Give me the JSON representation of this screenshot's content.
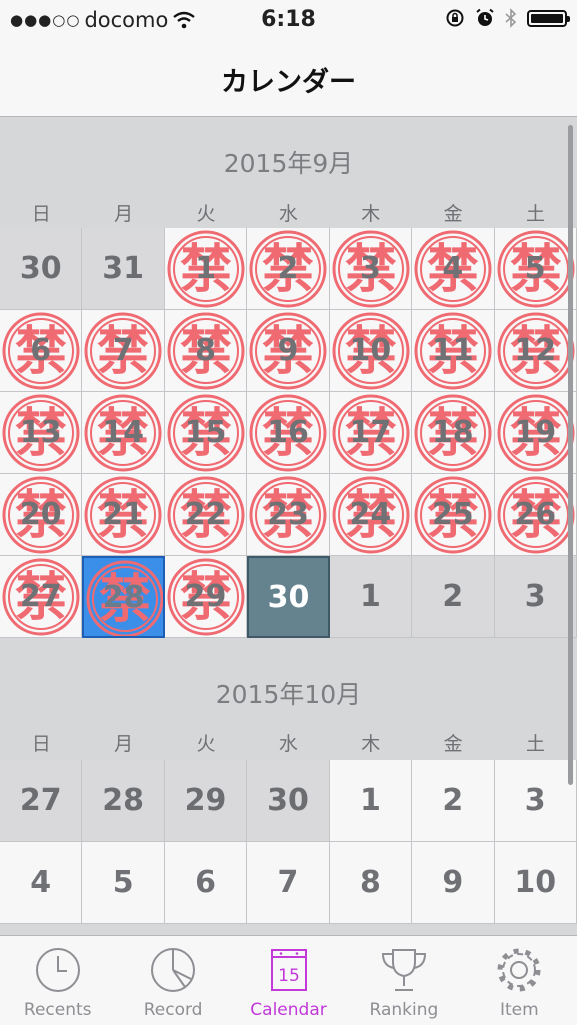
{
  "status_bar": {
    "signal": "●●●○○",
    "carrier": "docomo",
    "time": "6:18"
  },
  "nav": {
    "title": "カレンダー"
  },
  "weekdays": [
    "日",
    "月",
    "火",
    "水",
    "木",
    "金",
    "土"
  ],
  "months": [
    {
      "title": "2015年9月",
      "days": [
        {
          "n": "30",
          "other": true,
          "stamp": false
        },
        {
          "n": "31",
          "other": true,
          "stamp": false
        },
        {
          "n": "1",
          "stamp": true
        },
        {
          "n": "2",
          "stamp": true
        },
        {
          "n": "3",
          "stamp": true
        },
        {
          "n": "4",
          "stamp": true
        },
        {
          "n": "5",
          "stamp": true
        },
        {
          "n": "6",
          "stamp": true
        },
        {
          "n": "7",
          "stamp": true
        },
        {
          "n": "8",
          "stamp": true
        },
        {
          "n": "9",
          "stamp": true
        },
        {
          "n": "10",
          "stamp": true
        },
        {
          "n": "11",
          "stamp": true
        },
        {
          "n": "12",
          "stamp": true
        },
        {
          "n": "13",
          "stamp": true
        },
        {
          "n": "14",
          "stamp": true
        },
        {
          "n": "15",
          "stamp": true
        },
        {
          "n": "16",
          "stamp": true
        },
        {
          "n": "17",
          "stamp": true
        },
        {
          "n": "18",
          "stamp": true
        },
        {
          "n": "19",
          "stamp": true
        },
        {
          "n": "20",
          "stamp": true
        },
        {
          "n": "21",
          "stamp": true
        },
        {
          "n": "22",
          "stamp": true
        },
        {
          "n": "23",
          "stamp": true
        },
        {
          "n": "24",
          "stamp": true
        },
        {
          "n": "25",
          "stamp": true
        },
        {
          "n": "26",
          "stamp": true
        },
        {
          "n": "27",
          "stamp": true
        },
        {
          "n": "28",
          "stamp": true,
          "selected": true
        },
        {
          "n": "29",
          "stamp": true
        },
        {
          "n": "30",
          "today": true
        },
        {
          "n": "1",
          "other": true
        },
        {
          "n": "2",
          "other": true
        },
        {
          "n": "3",
          "other": true
        }
      ]
    },
    {
      "title": "2015年10月",
      "days": [
        {
          "n": "27",
          "other": true
        },
        {
          "n": "28",
          "other": true
        },
        {
          "n": "29",
          "other": true
        },
        {
          "n": "30",
          "other": true
        },
        {
          "n": "1"
        },
        {
          "n": "2"
        },
        {
          "n": "3"
        },
        {
          "n": "4"
        },
        {
          "n": "5"
        },
        {
          "n": "6"
        },
        {
          "n": "7"
        },
        {
          "n": "8"
        },
        {
          "n": "9"
        },
        {
          "n": "10"
        }
      ]
    }
  ],
  "stamp_text": "禁",
  "tabs": [
    {
      "label": "Recents",
      "icon": "clock-icon"
    },
    {
      "label": "Record",
      "icon": "pie-chart-icon"
    },
    {
      "label": "Calendar",
      "icon": "calendar-icon",
      "badge": "15",
      "active": true
    },
    {
      "label": "Ranking",
      "icon": "trophy-icon"
    },
    {
      "label": "Item",
      "icon": "gear-icon"
    }
  ],
  "colors": {
    "accent": "#c238d8",
    "stamp": "#f06a72",
    "selected": "#3b8fe8",
    "today": "#65828f"
  }
}
